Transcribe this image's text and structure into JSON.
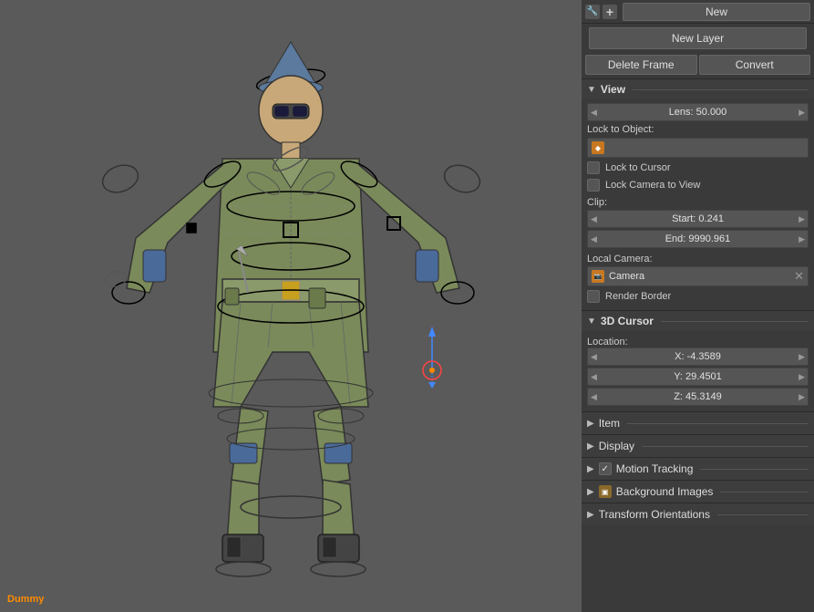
{
  "viewport": {
    "label": "Dummy",
    "background": "#5a5a5a"
  },
  "toolbar": {
    "new_label": "New",
    "new_layer_label": "New Layer",
    "delete_frame_label": "Delete Frame",
    "convert_label": "Convert"
  },
  "view_section": {
    "title": "View",
    "lens_label": "Lens: 50.000",
    "lock_to_object_label": "Lock to Object:",
    "lock_to_cursor_label": "Lock to Cursor",
    "lock_camera_label": "Lock Camera to View",
    "clip_label": "Clip:",
    "clip_start": "Start: 0.241",
    "clip_end": "End: 9990.961",
    "local_camera_label": "Local Camera:",
    "camera_name": "Camera",
    "render_border_label": "Render Border"
  },
  "cursor_section": {
    "title": "3D Cursor",
    "location_label": "Location:",
    "x_label": "X: -4.3589",
    "y_label": "Y: 29.4501",
    "z_label": "Z: 45.3149"
  },
  "collapsed_sections": {
    "item": "Item",
    "display": "Display",
    "motion_tracking": "Motion Tracking",
    "background_images": "Background Images",
    "transform_orientations": "Transform Orientations"
  },
  "icons": {
    "tool": "🔧",
    "add": "+",
    "camera": "📷",
    "object": "◆",
    "check": "✓"
  }
}
